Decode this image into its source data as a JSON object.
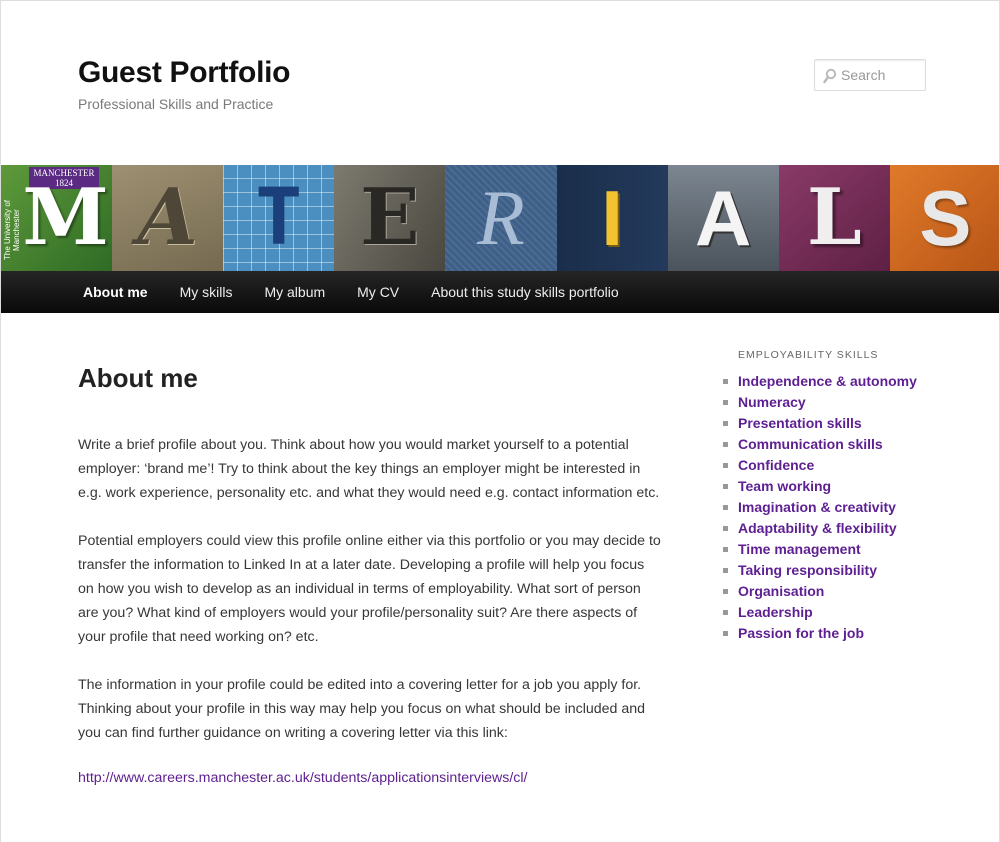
{
  "header": {
    "site_title": "Guest Portfolio",
    "site_description": "Professional Skills and Practice",
    "search_placeholder": "Search"
  },
  "banner": {
    "logo_text": "MANCHESTER 1824",
    "logo_side_text": "The University of Manchester",
    "letters": [
      "M",
      "A",
      "T",
      "E",
      "R",
      "I",
      "A",
      "L",
      "S"
    ]
  },
  "nav": {
    "items": [
      {
        "label": "About me",
        "current": true
      },
      {
        "label": "My skills"
      },
      {
        "label": "My album"
      },
      {
        "label": "My CV"
      },
      {
        "label": "About this study skills portfolio"
      }
    ]
  },
  "main": {
    "title": "About me",
    "paragraphs": [
      "Write a brief profile about you. Think about how you would market yourself to a potential employer: ‘brand me’! Try to think about the key things an employer might be interested in e.g. work experience, personality etc. and what they would need e.g. contact information etc.",
      "Potential employers could view this profile online either via this portfolio or you may decide to transfer the information to Linked In at a later date. Developing a profile will help you focus on how you wish to develop as an individual in terms of employability. What sort of person are you? What kind of employers would your profile/personality suit? Are there aspects of your profile that need working on? etc.",
      "The information in your profile could be edited into a covering letter for a job you apply for. Thinking about your profile in this way may help you focus on what should be included and you can find further guidance on writing a covering letter via this link:"
    ],
    "link_text": "http://www.careers.manchester.ac.uk/students/applicationsinterviews/cl/"
  },
  "sidebar": {
    "heading": "Employability Skills",
    "items": [
      "Independence & autonomy",
      "Numeracy",
      "Presentation skills",
      "Communication skills",
      "Confidence",
      "Team working",
      "Imagination & creativity",
      "Adaptability & flexibility",
      "Time management",
      "Taking responsibility",
      "Organisation",
      "Leadership",
      "Passion for the job"
    ]
  },
  "colors": {
    "link": "#5d1f91",
    "nav_bg": "#0a0a0a",
    "brand_purple": "#5b2a82"
  },
  "icons": {
    "search": "search-icon"
  }
}
